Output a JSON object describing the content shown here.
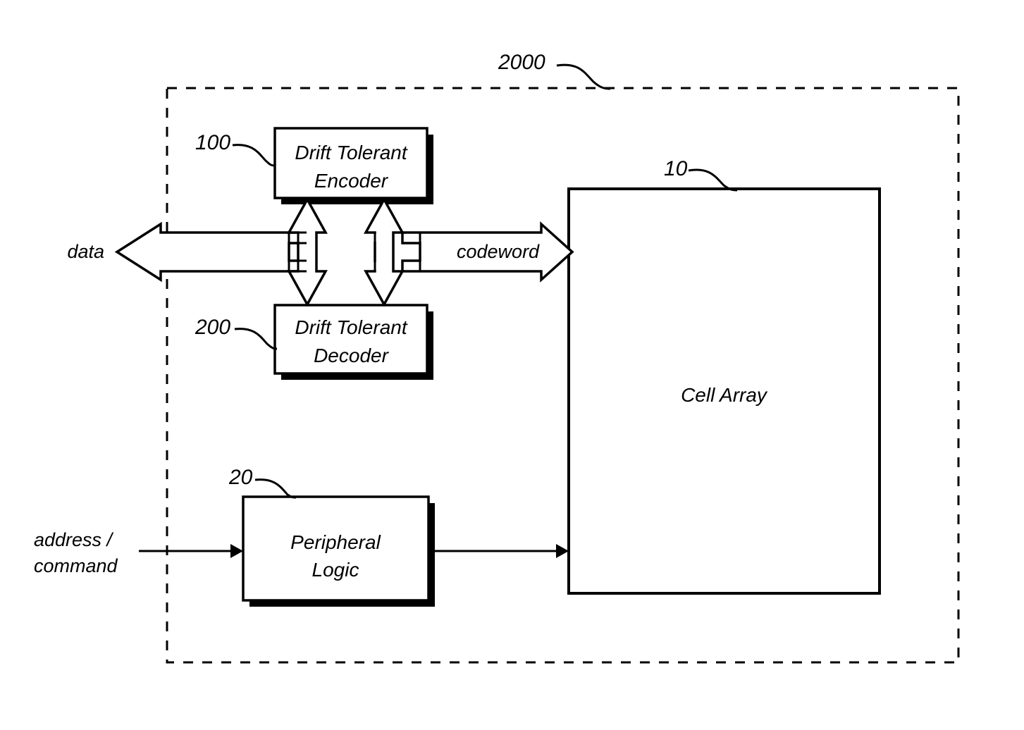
{
  "figure": {
    "type": "patent-block-diagram",
    "device_reference": "2000",
    "background_color": "#ffffff",
    "line_color": "#000000"
  },
  "boundary": {
    "name": "memory-device-boundary",
    "ref": "2000",
    "style": "dashed"
  },
  "blocks": [
    {
      "id": "encoder",
      "ref": "100",
      "line1": "Drift Tolerant",
      "line2": "Encoder",
      "shadow": true
    },
    {
      "id": "decoder",
      "ref": "200",
      "line1": "Drift Tolerant",
      "line2": "Decoder",
      "shadow": true
    },
    {
      "id": "peripheral",
      "ref": "20",
      "line1": "Peripheral",
      "line2": "Logic",
      "shadow": true
    },
    {
      "id": "cell-array",
      "ref": "10",
      "line1": "Cell Array",
      "line2": "",
      "shadow": false
    }
  ],
  "signals": {
    "data_label": "data",
    "codeword_label": "codeword",
    "address_command_line1": "address /",
    "address_command_line2": "command"
  },
  "refs": {
    "device": "2000",
    "encoder": "100",
    "decoder": "200",
    "peripheral": "20",
    "cell_array": "10"
  }
}
